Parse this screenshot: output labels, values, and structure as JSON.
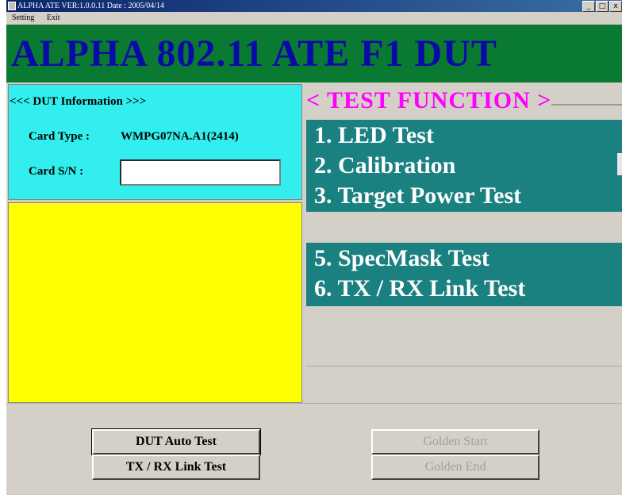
{
  "window": {
    "title": "ALPHA ATE   VER:1.0.0.11  Date : 2005/04/14",
    "controls": {
      "minimize": "_",
      "maximize": "□",
      "close": "x"
    }
  },
  "menu": {
    "items": [
      "Setting",
      "Exit"
    ]
  },
  "banner": {
    "text": "ALPHA  802.11  ATE  F1 DUT"
  },
  "dut_info": {
    "header": "<<< DUT Information >>>",
    "card_type_label": "Card Type :",
    "card_type_value": "WMPG07NA.A1(2414)",
    "card_sn_label": "Card S/N   :",
    "card_sn_value": ""
  },
  "test_function": {
    "header": "< TEST   FUNCTION >",
    "items": [
      "1.  LED  Test",
      "2.  Calibration",
      "3.  Target Power Test",
      "5.  SpecMask Test",
      "6.  TX / RX Link Test"
    ]
  },
  "buttons": {
    "dut_auto": "DUT Auto Test",
    "txrx_link": "TX / RX Link Test",
    "golden_start": "Golden Start",
    "golden_end": "Golden End"
  }
}
